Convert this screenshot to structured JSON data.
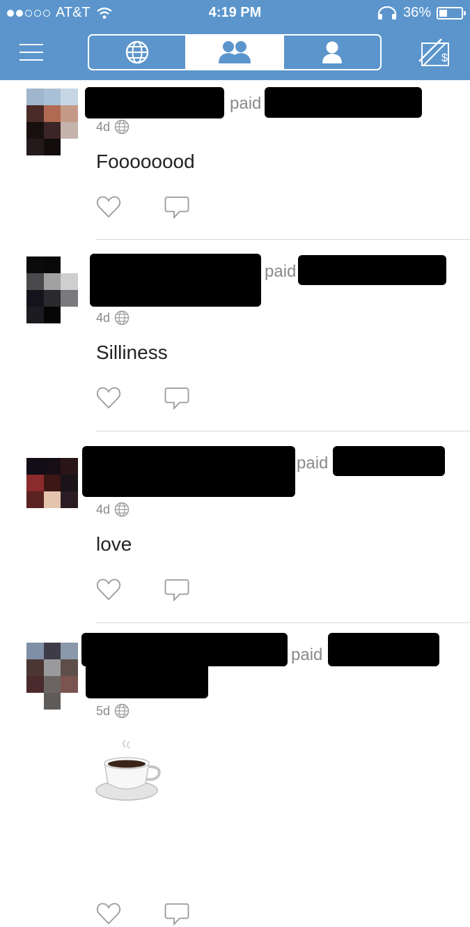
{
  "status_bar": {
    "carrier": "AT&T",
    "time": "4:19 PM",
    "battery": "36%",
    "battery_level": 0.36,
    "signal_bars_filled": 2,
    "signal_bars_total": 5
  },
  "nav": {
    "active_tab": "friends",
    "tabs": [
      "public",
      "friends",
      "personal"
    ],
    "icons": [
      "menu-icon",
      "globe-icon",
      "friends-icon",
      "person-icon",
      "pay-charge-icon"
    ]
  },
  "feed": {
    "posts": [
      {
        "paid_label": "paid",
        "age": "4d",
        "message": "Foooooood",
        "visibility_icon": "globe-icon"
      },
      {
        "paid_label": "paid",
        "age": "4d",
        "message": "Silliness",
        "visibility_icon": "globe-icon"
      },
      {
        "paid_label": "paid",
        "age": "4d",
        "message": "love",
        "visibility_icon": "globe-icon"
      },
      {
        "paid_label": "paid",
        "age": "5d",
        "message": "",
        "emoji": "coffee-cup",
        "visibility_icon": "globe-icon"
      }
    ]
  },
  "colors": {
    "brand_blue": "#5b95cc",
    "meta_gray": "#8a8a8a",
    "text_dark": "#222222",
    "divider": "#d8d8d8"
  }
}
